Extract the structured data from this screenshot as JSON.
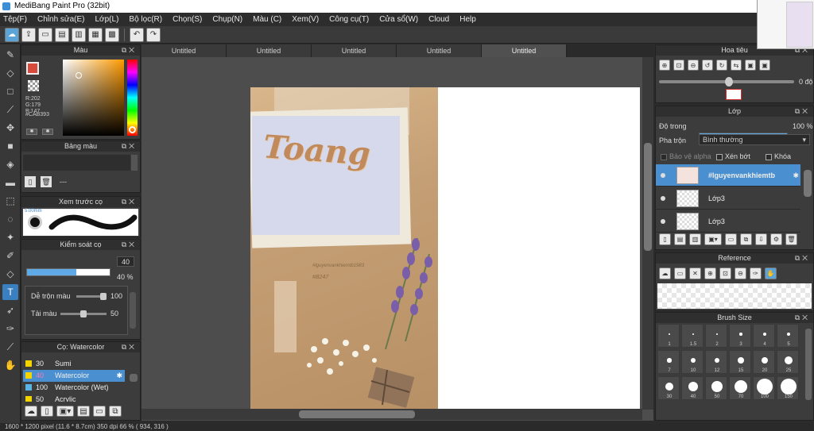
{
  "window": {
    "title": "MediBang Paint Pro (32bit)"
  },
  "menu": [
    "Tệp(F)",
    "Chỉnh sửa(E)",
    "Lớp(L)",
    "Bộ lọc(R)",
    "Chọn(S)",
    "Chụp(N)",
    "Màu (C)",
    "Xem(V)",
    "Công cụ(T)",
    "Cửa sổ(W)",
    "Cloud",
    "Help"
  ],
  "tabs": [
    "Untitled",
    "Untitled",
    "Untitled",
    "Untitled",
    "Untitled"
  ],
  "color_panel": {
    "title": "Màu",
    "r": "R:202",
    "g": "G:179",
    "b": "B:147",
    "hex": "#CAB393",
    "current_color": "#CAB393"
  },
  "palette_panel": {
    "title": "Bảng màu",
    "value": "---"
  },
  "brush_preview": {
    "title": "Xem trước cọ",
    "size": "5.00mm"
  },
  "brush_control": {
    "title": "Kiểm soát cọ",
    "size_value": "40",
    "size_fraction": 0.6,
    "opacity_value": "40 %",
    "opacity_fraction": 0.4,
    "mix_label": "Dễ trộn màu",
    "mix_value": "100",
    "mix_fraction": 1.0,
    "load_label": "Tải màu",
    "load_value": "50",
    "load_fraction": 0.5
  },
  "brush_panel": {
    "title": "Cọ: Watercolor",
    "items": [
      {
        "num": "30",
        "name": "Sumi",
        "color": "#f2d400",
        "selected": false
      },
      {
        "num": "40",
        "name": "Watercolor",
        "color": "#f2d400",
        "selected": true
      },
      {
        "num": "100",
        "name": "Watercolor (Wet)",
        "color": "#f2d400",
        "selected": false
      },
      {
        "num": "50",
        "name": "Acrylic",
        "color": "#f2d400",
        "selected": false
      }
    ]
  },
  "navigator": {
    "title": "Hoa tiêu",
    "angle": "0 độ"
  },
  "layer_panel": {
    "title": "Lớp",
    "opacity_label": "Độ trong",
    "opacity_value": "100 %",
    "opacity_fraction": 1.0,
    "blend_label": "Pha trộn",
    "blend_value": "Bình thường",
    "protect_alpha": "Bảo vệ alpha",
    "clipping": "Xén bớt",
    "lock": "Khóa",
    "layers": [
      {
        "name": "#lguyenvankhiemtb",
        "selected": true
      },
      {
        "name": "Lớp3",
        "selected": false
      },
      {
        "name": "Lớp3",
        "selected": false
      }
    ]
  },
  "reference": {
    "title": "Reference"
  },
  "brush_size": {
    "title": "Brush Size",
    "sizes": [
      "1",
      "1.5",
      "2",
      "3",
      "4",
      "5",
      "7",
      "10",
      "12",
      "15",
      "20",
      "25",
      "30",
      "40",
      "50",
      "70",
      "100",
      "150"
    ]
  },
  "artwork": {
    "title_text": "Toang",
    "tag_text": "#lguyenvankhiemtb1983",
    "code_text": "#B247"
  },
  "status": {
    "text": "1600 * 1200 pixel  (11.6 * 8.7cm)  350 dpi  66 %  ( 934, 316 )"
  },
  "colors": {
    "accent": "#3a7fc0",
    "selection": "#4a90d0"
  }
}
